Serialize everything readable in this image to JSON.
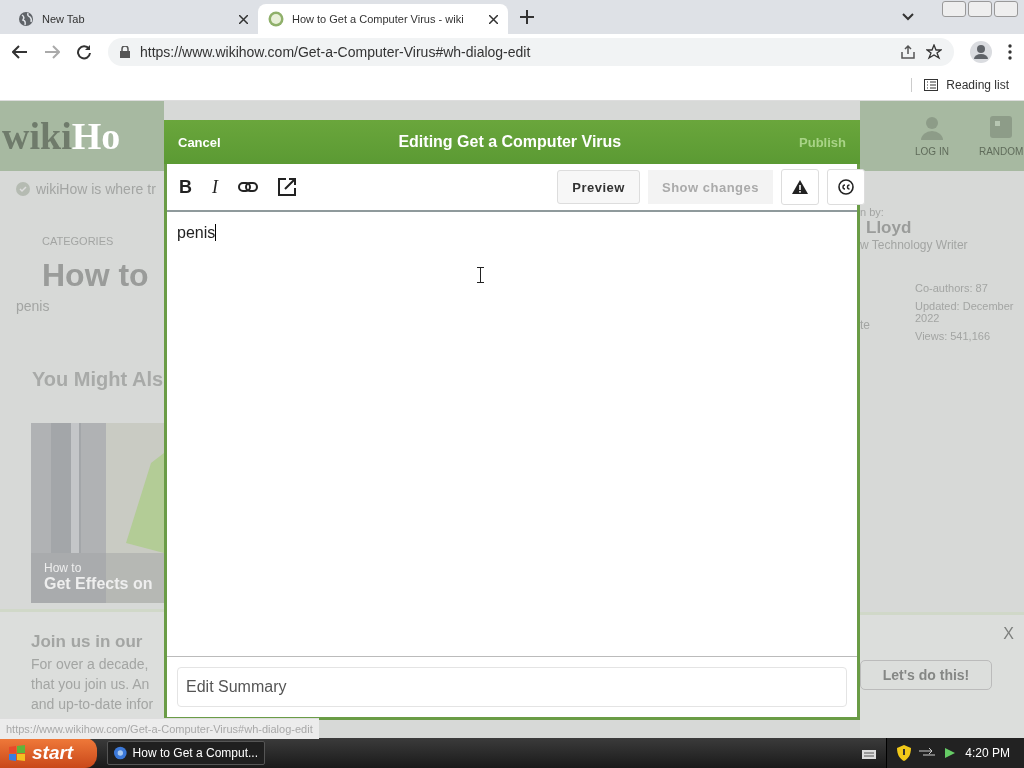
{
  "browser": {
    "tabs": [
      {
        "title": "New Tab",
        "selected": false,
        "kind": "globe"
      },
      {
        "title": "How to Get a Computer Virus - wiki",
        "selected": true,
        "kind": "site"
      }
    ],
    "address": "https://www.wikihow.com/Get-a-Computer-Virus#wh-dialog-edit",
    "reading_list": "Reading list",
    "status_url": "https://www.wikihow.com/Get-a-Computer-Virus#wh-dialog-edit"
  },
  "background_left": {
    "logo_dark": "wiki",
    "logo_light": "Ho",
    "tagline": "wikiHow is where tr",
    "categories": "CATEGORIES",
    "title": "How to",
    "typed": "penis",
    "might_also": "You Might Als",
    "card_kicker": "How to",
    "card_title": "Get Effects on",
    "join_title": "Join us in our",
    "join_lines": [
      "For over a decade,",
      "that you join us. An",
      "and up-to-date infor"
    ]
  },
  "background_right": {
    "nav": [
      "LOG IN",
      "RANDOM"
    ],
    "written_by": "n by:",
    "author": "Lloyd",
    "author_role": "w Technology Writer",
    "cut_word": "te",
    "stats": [
      "Co-authors: 87",
      "Updated: December",
      "2022",
      "Views: 541,166"
    ],
    "close": "X",
    "cta": "Let's do this!"
  },
  "dialog": {
    "cancel": "Cancel",
    "title": "Editing Get a Computer Virus",
    "publish": "Publish",
    "tools": [
      "B",
      "I"
    ],
    "preview": "Preview",
    "show_changes": "Show changes",
    "body": "penis",
    "summary_placeholder": "Edit Summary"
  },
  "taskbar": {
    "start": "start",
    "task": "How to Get a Comput...",
    "clock": "4:20 PM"
  }
}
